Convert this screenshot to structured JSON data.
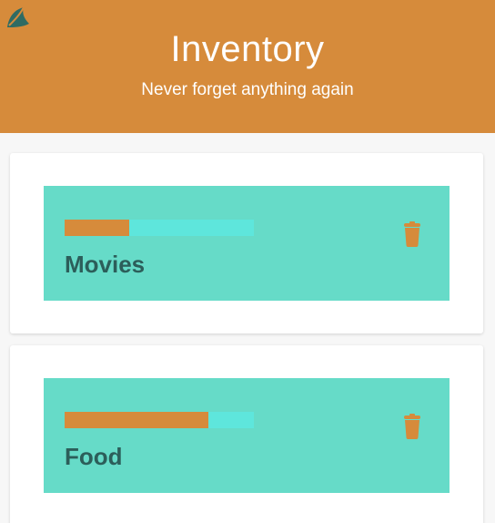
{
  "header": {
    "title": "Inventory",
    "subtitle": "Never forget anything again",
    "logo_icon": "leaf-logo-icon"
  },
  "colors": {
    "header_bg": "#d68b3b",
    "item_bg": "#66dbc8",
    "progress_track": "#5ee6dc",
    "progress_fill": "#d68b3b",
    "label_color": "#2c5e5a",
    "logo_color": "#2f6b63"
  },
  "categories": [
    {
      "label": "Movies",
      "progress": 0.34,
      "delete_icon": "trash-icon"
    },
    {
      "label": "Food",
      "progress": 0.76,
      "delete_icon": "trash-icon"
    }
  ]
}
